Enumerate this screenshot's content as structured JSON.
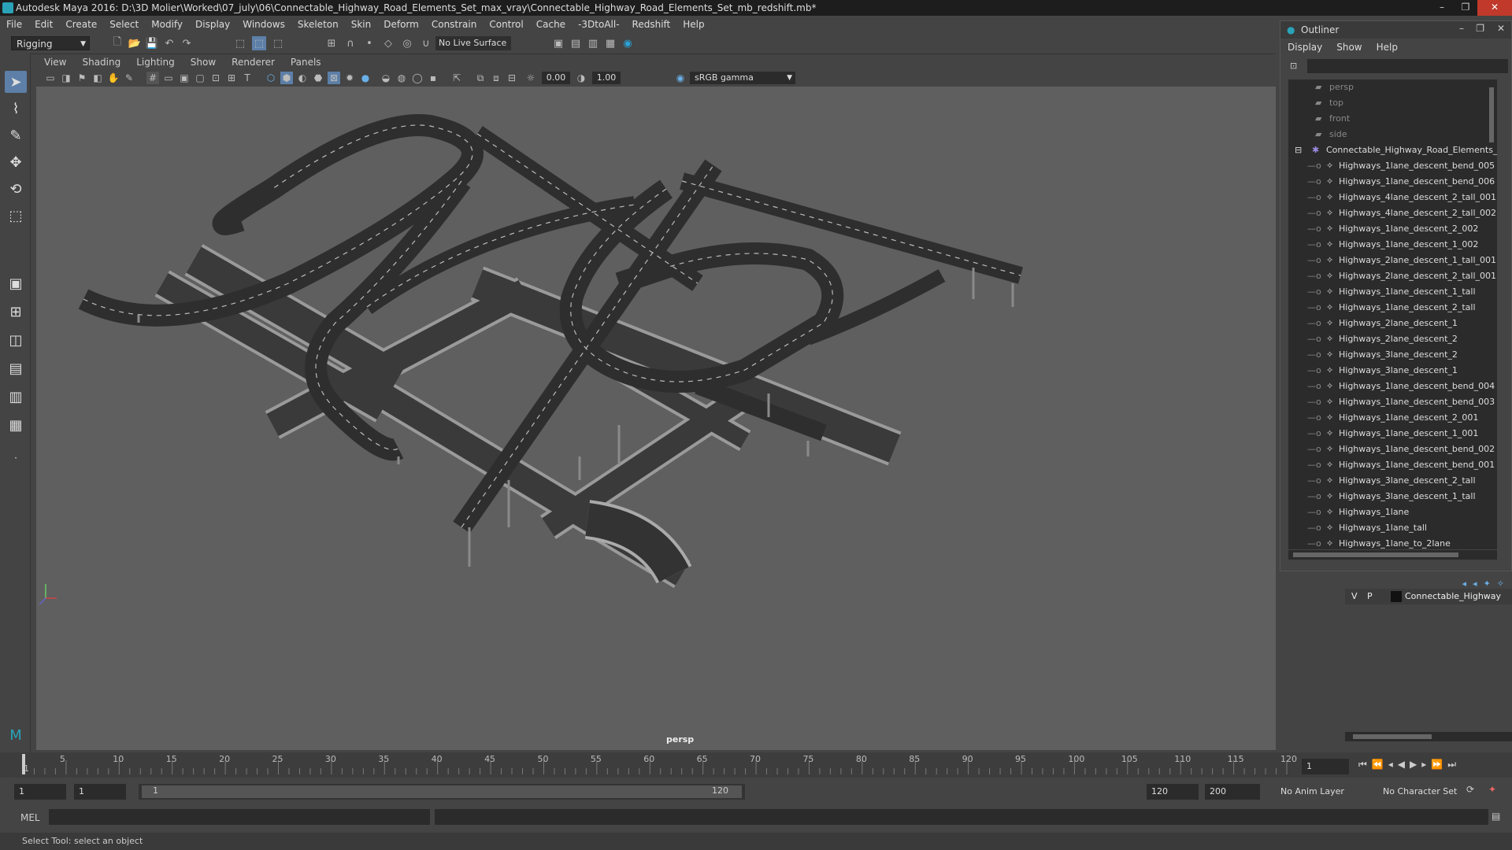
{
  "window": {
    "title": "Autodesk Maya 2016: D:\\3D Molier\\Worked\\07_july\\06\\Connectable_Highway_Road_Elements_Set_max_vray\\Connectable_Highway_Road_Elements_Set_mb_redshift.mb*"
  },
  "menubar": {
    "items": [
      "File",
      "Edit",
      "Create",
      "Select",
      "Modify",
      "Display",
      "Windows",
      "Skeleton",
      "Skin",
      "Deform",
      "Constrain",
      "Control",
      "Cache",
      "-3DtoAll-",
      "Redshift",
      "Help"
    ]
  },
  "statusline": {
    "mode": "Rigging",
    "live_surface": "No Live Surface"
  },
  "panel": {
    "menus": [
      "View",
      "Shading",
      "Lighting",
      "Show",
      "Renderer",
      "Panels"
    ],
    "exposure": "0.00",
    "gamma_value": "1.00",
    "color_space": "sRGB gamma",
    "camera_label": "persp"
  },
  "timeline": {
    "ticks": [
      "1",
      "5",
      "10",
      "15",
      "20",
      "25",
      "30",
      "35",
      "40",
      "45",
      "50",
      "55",
      "60",
      "65",
      "70",
      "75",
      "80",
      "85",
      "90",
      "95",
      "100",
      "105",
      "110",
      "115",
      "120"
    ],
    "current_frame": "1"
  },
  "range": {
    "start": "1",
    "current": "1",
    "range_start": "1",
    "range_end": "120",
    "end": "120",
    "max": "200",
    "anim_layer": "No Anim Layer",
    "character_set": "No Character Set"
  },
  "command": {
    "lang": "MEL"
  },
  "help": {
    "text": "Select Tool: select an object"
  },
  "outliner": {
    "title": "Outliner",
    "menus": [
      "Display",
      "Show",
      "Help"
    ],
    "cameras": [
      "persp",
      "top",
      "front",
      "side"
    ],
    "group": "Connectable_Highway_Road_Elements_S",
    "children": [
      "Highways_1lane_descent_bend_005",
      "Highways_1lane_descent_bend_006",
      "Highways_4lane_descent_2_tall_001",
      "Highways_4lane_descent_2_tall_002",
      "Highways_1lane_descent_2_002",
      "Highways_1lane_descent_1_002",
      "Highways_2lane_descent_1_tall_001",
      "Highways_2lane_descent_2_tall_001",
      "Highways_1lane_descent_1_tall",
      "Highways_1lane_descent_2_tall",
      "Highways_2lane_descent_1",
      "Highways_2lane_descent_2",
      "Highways_3lane_descent_2",
      "Highways_3lane_descent_1",
      "Highways_1lane_descent_bend_004",
      "Highways_1lane_descent_bend_003",
      "Highways_1lane_descent_2_001",
      "Highways_1lane_descent_1_001",
      "Highways_1lane_descent_bend_002",
      "Highways_1lane_descent_bend_001",
      "Highways_3lane_descent_2_tall",
      "Highways_3lane_descent_1_tall",
      "Highways_1lane",
      "Highways_1lane_tall",
      "Highways_1lane_to_2lane"
    ]
  },
  "layers": {
    "v": "V",
    "p": "P",
    "name": "Connectable_Highway"
  }
}
